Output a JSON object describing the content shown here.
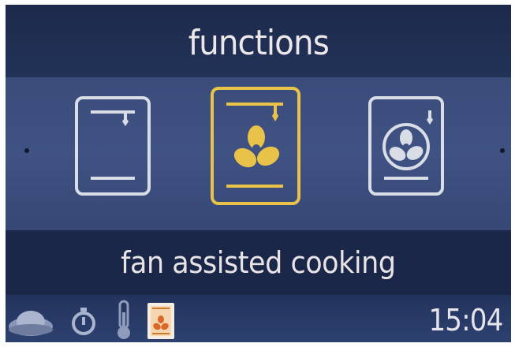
{
  "header": {
    "title": "functions"
  },
  "carousel": {
    "items": [
      {
        "icon": "conventional-oven-icon",
        "selected": false
      },
      {
        "icon": "fan-assisted-oven-icon",
        "selected": true
      },
      {
        "icon": "fan-oven-icon",
        "selected": false
      }
    ],
    "selected_label": "fan assisted cooking"
  },
  "status": {
    "icons": [
      "dish-icon",
      "timer-icon",
      "thermometer-icon",
      "selected-function-icon"
    ],
    "time": "15:04"
  },
  "colors": {
    "background": "#141f3a",
    "band": "#3f5283",
    "selected": "#e9c24a",
    "icon": "#d8dde6"
  }
}
